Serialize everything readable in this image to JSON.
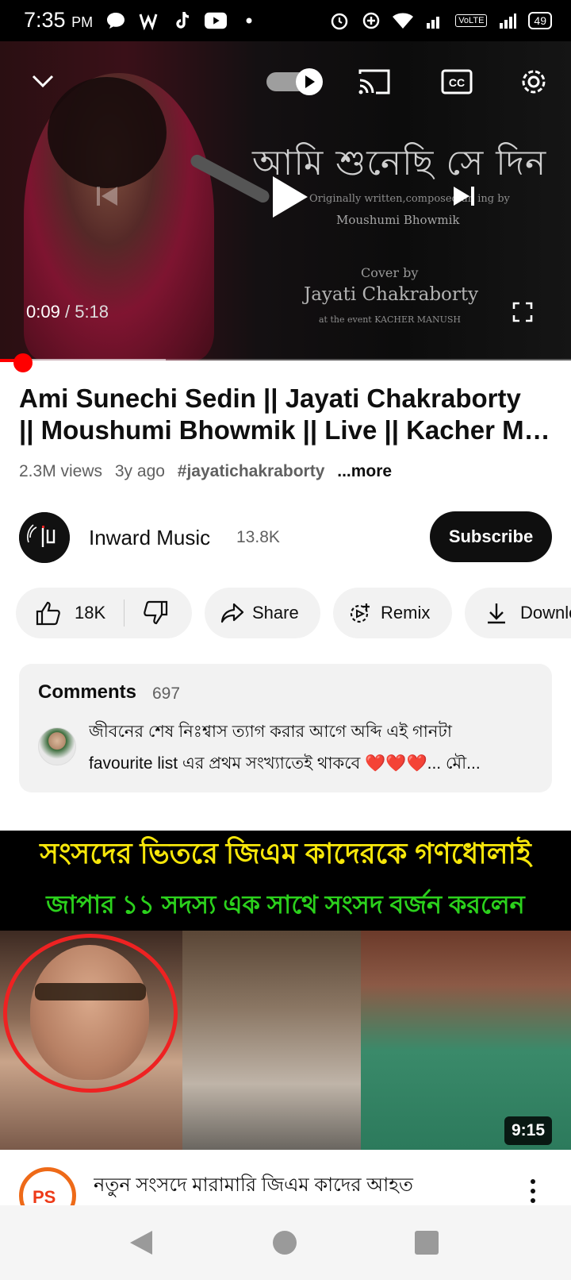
{
  "status_bar": {
    "time": "7:35",
    "ampm": "PM",
    "network": "VoLTE",
    "battery": "49"
  },
  "player": {
    "overlay_text": {
      "song_bengali": "আমি শুনেছি সে দিন",
      "credit_line": "Originally written,composed an   ing by",
      "credit_name": "Moushumi Bhowmik",
      "cover_label": "Cover by",
      "cover_artist": "Jayati Chakraborty",
      "event_line": "at the event KACHER MANUSH"
    },
    "current_time": "0:09",
    "separator": "/",
    "duration": "5:18",
    "progress_fraction": 0.029,
    "buffered_fraction": 0.29
  },
  "video": {
    "title_line1": "Ami Sunechi Sedin || Jayati Chakraborty",
    "title_line2": "|| Moushumi Bhowmik || Live || Kacher M…",
    "views": "2.3M views",
    "age": "3y ago",
    "hashtag": "#jayatichakraborty",
    "more": "...more"
  },
  "channel": {
    "name": "Inward Music",
    "subscribers": "13.8K",
    "subscribe_label": "Subscribe"
  },
  "actions": {
    "likes": "18K",
    "share": "Share",
    "remix": "Remix",
    "download": "Download"
  },
  "comments": {
    "heading": "Comments",
    "count": "697",
    "top_comment_line1": "জীবনের শেষ নিঃশ্বাস ত্যাগ করার আগে অব্দি এই গানটা",
    "top_comment_line2": "favourite list এর প্রথম সংখ্যাতেই থাকবে ❤️❤️❤️... মৌ..."
  },
  "next_video": {
    "thumb_line1": "সংসদের ভিতরে জিএম কাদেরকে গণধোলাই",
    "thumb_line2": "জাপার ১১ সদস্য এক সাথে সংসদ বর্জন করলেন",
    "duration": "9:15",
    "channel_badge": "PS",
    "title": "নতুন সংসদে মারামারি জিএম কাদের আহত"
  },
  "colors": {
    "progress_red": "#ff0000",
    "subscribe_bg": "#0f0f0f",
    "pill_bg": "#f2f2f2",
    "thumb_yellow": "#f6e60a",
    "thumb_green": "#2bd11c"
  }
}
